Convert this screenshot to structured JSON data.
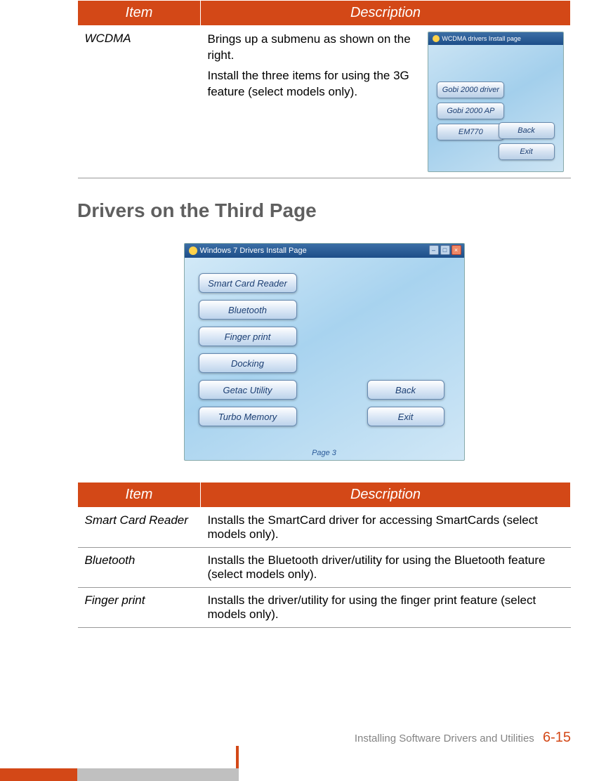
{
  "table1": {
    "headers": {
      "item": "Item",
      "description": "Description"
    },
    "rows": [
      {
        "item": "WCDMA",
        "desc1": "Brings up a submenu as shown on the right.",
        "desc2": "Install the three items for using the 3G feature (select models only)."
      }
    ]
  },
  "mini_installer": {
    "title": "WCDMA drivers Install page",
    "buttons_left": [
      "Gobi 2000 driver",
      "Gobi 2000 AP",
      "EM770"
    ],
    "buttons_right": [
      "Back",
      "Exit"
    ]
  },
  "section_title": "Drivers on the Third Page",
  "big_installer": {
    "title": "Windows 7 Drivers Install Page",
    "buttons_left": [
      "Smart Card Reader",
      "Bluetooth",
      "Finger print",
      "Docking",
      "Getac Utility",
      "Turbo Memory"
    ],
    "buttons_right": [
      "Back",
      "Exit"
    ],
    "page_label": "Page 3"
  },
  "table2": {
    "headers": {
      "item": "Item",
      "description": "Description"
    },
    "rows": [
      {
        "item": "Smart Card Reader",
        "desc": "Installs the SmartCard driver for accessing SmartCards (select models only)."
      },
      {
        "item": "Bluetooth",
        "desc": "Installs the Bluetooth driver/utility for using the Bluetooth feature (select models only)."
      },
      {
        "item": "Finger print",
        "desc": "Installs the driver/utility for using the finger print feature (select models only)."
      }
    ]
  },
  "footer": {
    "section": "Installing Software Drivers and Utilities",
    "page": "6-15"
  }
}
